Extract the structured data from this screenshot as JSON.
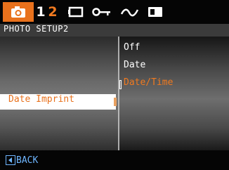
{
  "tabs": [
    {
      "id": "camera",
      "icon": "camera-icon",
      "active": true
    },
    {
      "id": "1",
      "label": "1"
    },
    {
      "id": "2",
      "label": "2",
      "active": true
    },
    {
      "id": "frame",
      "icon": "frame-icon"
    },
    {
      "id": "key",
      "icon": "key-icon"
    },
    {
      "id": "wave",
      "icon": "wave-icon"
    },
    {
      "id": "card",
      "icon": "memory-card-icon"
    }
  ],
  "header": {
    "title": "PHOTO SETUP2"
  },
  "menu": {
    "selected_item": "Date Imprint"
  },
  "options": [
    {
      "label": "Off"
    },
    {
      "label": "Date"
    },
    {
      "label": "Date/Time",
      "selected": true
    }
  ],
  "footer": {
    "back_label": "BACK",
    "back_icon": "left-arrow-icon"
  },
  "colors": {
    "accent": "#e8711c",
    "highlight_text": "#f07a20",
    "footer_text": "#6fb6ff",
    "background": "#000000"
  }
}
